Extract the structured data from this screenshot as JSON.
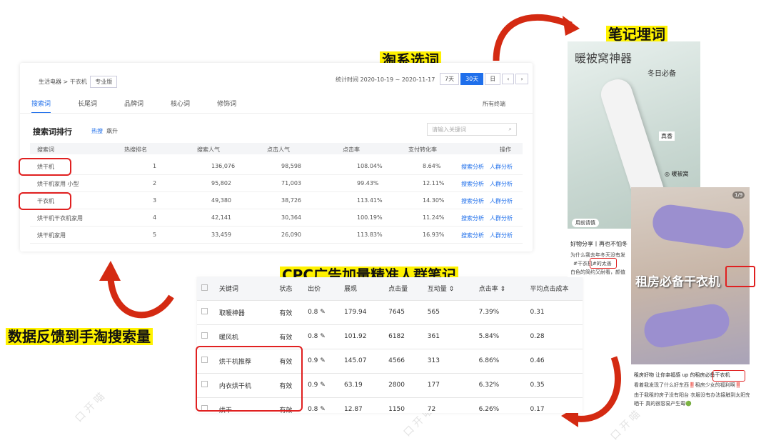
{
  "labels": {
    "tao": "淘系选词",
    "note": "笔记埋词",
    "cpc": "CPC广告加量精准人群笔记",
    "feedback": "数据反馈到手淘搜索量"
  },
  "panel": {
    "breadcrumb": "生活电器 > 干衣机",
    "edition": "专业版",
    "date_label": "统计时间 2020-10-19 ~ 2020-11-17",
    "range_buttons": [
      "7天",
      "30天",
      "日"
    ],
    "tabs": [
      "搜索词",
      "长尾词",
      "品牌词",
      "核心词",
      "修饰词"
    ],
    "filter": "所有终端",
    "section_title": "搜索词排行",
    "sub_tabs": [
      "热搜",
      "飙升"
    ],
    "search_placeholder": "请输入关键词",
    "headers": [
      "搜索词",
      "热搜排名",
      "搜索人气",
      "点击人气",
      "点击率",
      "支付转化率",
      "操作"
    ],
    "rows": [
      [
        "烘干机",
        "1",
        "136,076",
        "98,598",
        "108.04%",
        "8.64%"
      ],
      [
        "烘干机家用 小型",
        "2",
        "95,802",
        "71,003",
        "99.43%",
        "12.11%"
      ],
      [
        "干衣机",
        "3",
        "49,380",
        "38,726",
        "113.41%",
        "14.30%"
      ],
      [
        "烘干机干衣机家用",
        "4",
        "42,141",
        "30,364",
        "100.19%",
        "11.24%"
      ],
      [
        "烘干机家用",
        "5",
        "33,459",
        "26,090",
        "113.83%",
        "16.93%"
      ]
    ],
    "actions": [
      "搜索分析",
      "人群分析"
    ]
  },
  "cpc": {
    "headers": [
      "关键词",
      "状态",
      "出价",
      "展现",
      "点击量",
      "互动量 ⇕",
      "点击率 ⇕",
      "平均点击成本"
    ],
    "rows": [
      [
        "取暖神器",
        "有效",
        "0.8",
        "179.94",
        "7645",
        "565",
        "7.39%",
        "0.31"
      ],
      [
        "暖风机",
        "有效",
        "0.8",
        "101.92",
        "6182",
        "361",
        "5.84%",
        "0.28"
      ],
      [
        "烘干机推荐",
        "有效",
        "0.9",
        "145.07",
        "4566",
        "313",
        "6.86%",
        "0.46"
      ],
      [
        "内衣烘干机",
        "有效",
        "0.9",
        "63.19",
        "2800",
        "177",
        "6.32%",
        "0.35"
      ],
      [
        "烘干",
        "有效",
        "0.8",
        "12.87",
        "1150",
        "72",
        "6.26%",
        "0.17"
      ]
    ]
  },
  "note1": {
    "title": "暖被窝神器",
    "tag": "冬日必备",
    "tag2": "真香",
    "brand": "◎ 暖被窝",
    "caption": "好物分享丨再也不怕冬",
    "line1": "为什么我去年冬天没有发",
    "line2": "#干衣机#的太善",
    "line3": "白色的简约又耐看，颜值",
    "like": "用前请慎"
  },
  "note2": {
    "badge": "1/9",
    "banner": "租房必备干衣机",
    "line1": "租房好物 让你幸福感 up 的租房必备干衣机",
    "line2": "看着我发现了什么好东西‼️租房少女的福利啊‼️",
    "line3": "由于我租的房子没有阳台 衣服没有办法接触到太阳完全",
    "line4": "晒干 真的很容易产生霉🟢"
  }
}
